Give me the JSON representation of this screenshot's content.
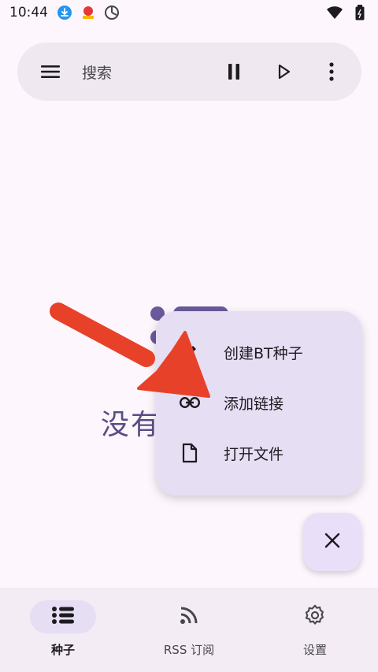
{
  "status_bar": {
    "time": "10:44",
    "icons_left": [
      "download-icon",
      "app-badge-icon",
      "sync-icon"
    ],
    "icons_right": [
      "wifi-icon",
      "battery-icon"
    ]
  },
  "search_bar": {
    "placeholder": "搜索",
    "actions": [
      "pause-icon",
      "play-icon",
      "more-vert-icon"
    ]
  },
  "empty_state": {
    "text": "没有"
  },
  "fab_menu": {
    "items": [
      {
        "label": "创建BT种子",
        "icon": "edit-icon"
      },
      {
        "label": "添加链接",
        "icon": "link-icon"
      },
      {
        "label": "打开文件",
        "icon": "file-icon"
      }
    ]
  },
  "fab": {
    "icon": "close-icon"
  },
  "bottom_nav": {
    "items": [
      {
        "label": "种子",
        "icon": "list-icon",
        "active": true
      },
      {
        "label": "RSS 订阅",
        "icon": "rss-icon",
        "active": false
      },
      {
        "label": "设置",
        "icon": "gear-icon",
        "active": false
      }
    ]
  },
  "colors": {
    "background": "#fdf7fd",
    "surface": "#efe8f0",
    "menu": "#e6def3",
    "accent": "#5a4d86",
    "arrow": "#e8412a"
  }
}
